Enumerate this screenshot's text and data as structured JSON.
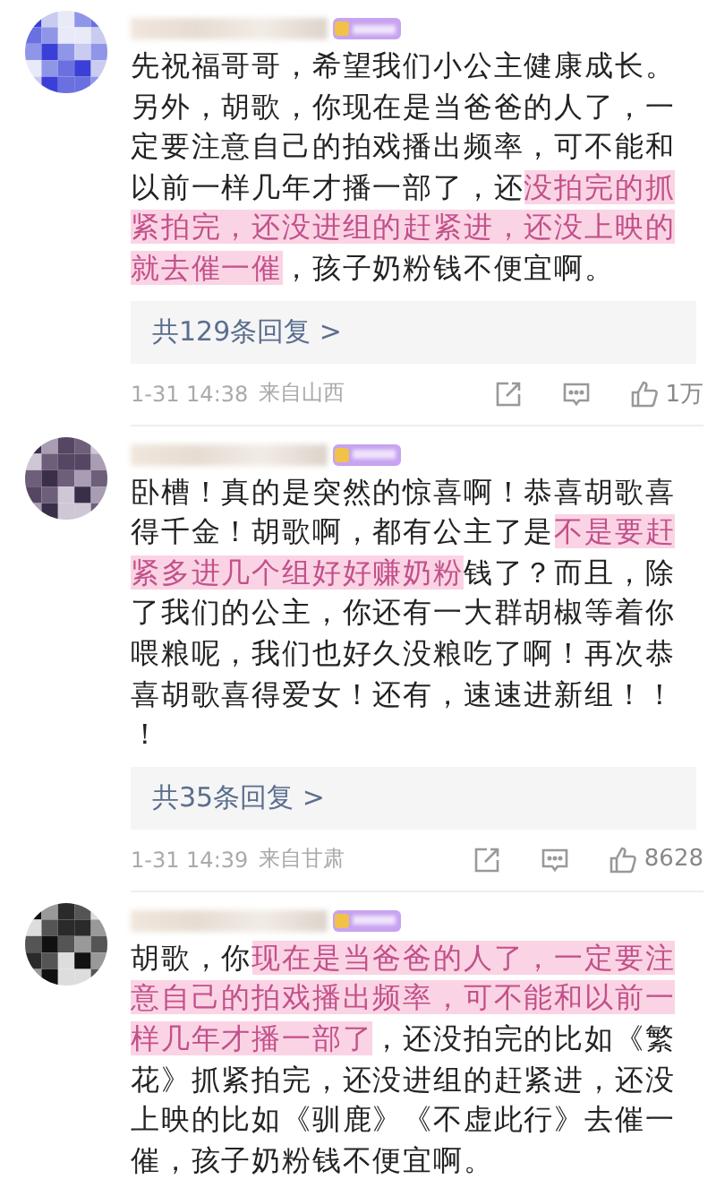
{
  "comments": [
    {
      "segments": [
        {
          "text": "先祝福哥哥，希望我们小公主健康成长。另外，胡歌，你现在是当爸爸的人了，一定要注意自己的拍戏播出频率，可不能和以前一样几年才播一部了，还",
          "highlighted": false
        },
        {
          "text": "没拍完的抓紧拍完，还没进组的赶紧进，还没上映的就去催一催",
          "highlighted": true
        },
        {
          "text": "，孩子奶粉钱不便宜啊。",
          "highlighted": false
        }
      ],
      "replies": "共129条回复 >",
      "time": "1-31 14:38",
      "location": "来自山西",
      "likes": "1万"
    },
    {
      "segments": [
        {
          "text": "卧槽！真的是突然的惊喜啊！恭喜胡歌喜得千金！胡歌啊，都有公主了是",
          "highlighted": false
        },
        {
          "text": "不是要赶紧多进几个组好好赚奶粉",
          "highlighted": true
        },
        {
          "text": "钱了？而且，除了我们的公主，你还有一大群胡椒等着你喂粮呢，我们也好久没粮吃了啊！再次恭喜胡歌喜得爱女！还有，速速进新组！！！",
          "highlighted": false
        }
      ],
      "replies": "共35条回复 >",
      "time": "1-31 14:39",
      "location": "来自甘肃",
      "likes": "8628"
    },
    {
      "segments": [
        {
          "text": "胡歌，你",
          "highlighted": false
        },
        {
          "text": "现在是当爸爸的人了，一定要注意自己的拍戏播出频率，可不能和以前一样几年才播一部了",
          "highlighted": true
        },
        {
          "text": "，还没拍完的比如《繁花》抓紧拍完，还没进组的赶紧进，还没上映的比如《驯鹿》《不虚此行》去催一催，孩子奶粉钱不便宜啊。",
          "highlighted": false
        }
      ]
    }
  ]
}
